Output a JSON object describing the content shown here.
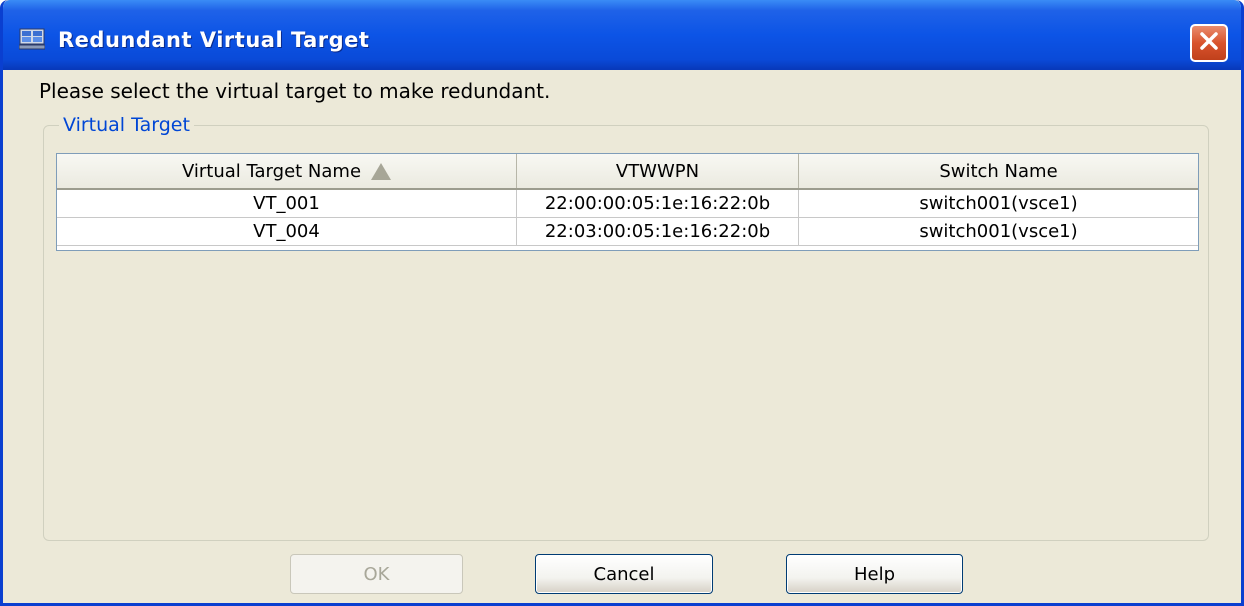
{
  "window": {
    "title": "Redundant Virtual Target",
    "icon": "virtual-target-app-icon",
    "close_icon": "close-icon"
  },
  "instruction": "Please select the virtual target to make redundant.",
  "group": {
    "label": "Virtual Target",
    "table": {
      "columns": [
        "Virtual Target Name",
        "VTWWPN",
        "Switch Name"
      ],
      "sort_icon": "sort-ascending-icon",
      "rows": [
        [
          "VT_001",
          "22:00:00:05:1e:16:22:0b",
          "switch001(vsce1)"
        ],
        [
          "VT_004",
          "22:03:00:05:1e:16:22:0b",
          "switch001(vsce1)"
        ]
      ]
    }
  },
  "buttons": {
    "ok": "OK",
    "cancel": "Cancel",
    "help": "Help"
  },
  "colors": {
    "title_bar": "#0a4ad8",
    "group_label": "#0046d5",
    "close_button": "#d9532c"
  }
}
